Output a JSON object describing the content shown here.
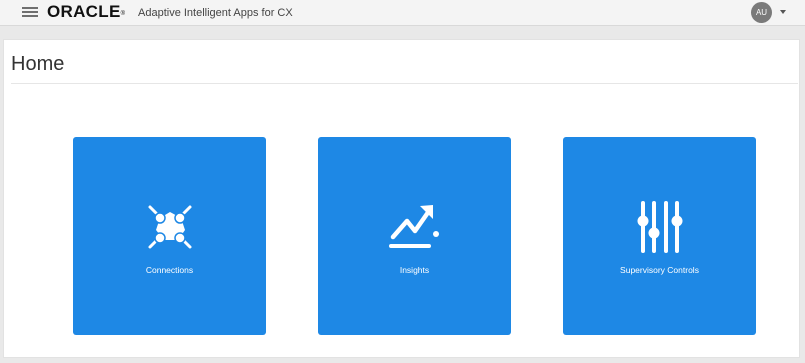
{
  "header": {
    "brand": "ORACLE",
    "brand_mark": "®",
    "app_title": "Adaptive Intelligent Apps for CX",
    "user_initials": "AU",
    "menu_icon": "hamburger-menu-icon",
    "user_menu_icon": "caret-down-icon"
  },
  "page": {
    "title": "Home"
  },
  "tiles": [
    {
      "label": "Connections",
      "icon": "connections-icon"
    },
    {
      "label": "Insights",
      "icon": "insights-trend-icon"
    },
    {
      "label": "Supervisory Controls",
      "icon": "sliders-icon"
    }
  ],
  "colors": {
    "tile_blue": "#1e88e5",
    "header_bg": "#f4f4f4",
    "avatar_bg": "#7a7a7a"
  }
}
